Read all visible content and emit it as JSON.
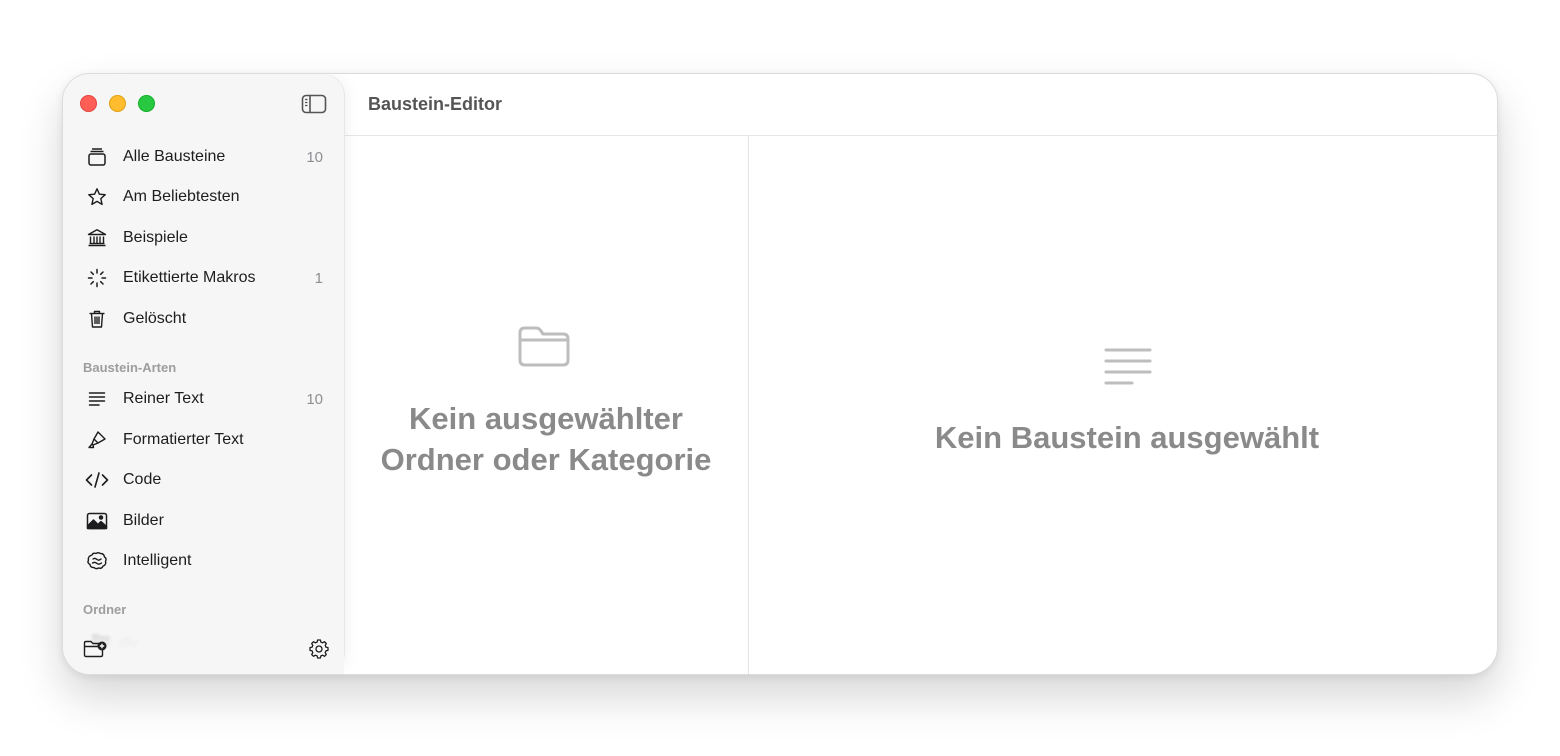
{
  "window": {
    "title": "Baustein-Editor"
  },
  "sidebar": {
    "library_items": [
      {
        "label": "Alle Bausteine",
        "count": "10",
        "icon": "tray-stack-icon"
      },
      {
        "label": "Am Beliebtesten",
        "count": "",
        "icon": "star-icon"
      },
      {
        "label": "Beispiele",
        "count": "",
        "icon": "building-columns-icon"
      },
      {
        "label": "Etikettierte Makros",
        "count": "1",
        "icon": "sparkle-burst-icon"
      },
      {
        "label": "Gelöscht",
        "count": "",
        "icon": "trash-icon"
      }
    ],
    "types_heading": "Baustein-Arten",
    "type_items": [
      {
        "label": "Reiner Text",
        "count": "10",
        "icon": "text-lines-icon"
      },
      {
        "label": "Formatierter Text",
        "count": "",
        "icon": "highlighter-icon"
      },
      {
        "label": "Code",
        "count": "",
        "icon": "code-brackets-icon"
      },
      {
        "label": "Bilder",
        "count": "",
        "icon": "photo-icon"
      },
      {
        "label": "Intelligent",
        "count": "",
        "icon": "brain-icon"
      }
    ],
    "folders_heading": "Ordner",
    "folders": [
      {
        "label": "djv",
        "icon": "folder-icon"
      }
    ]
  },
  "list_pane": {
    "empty_message_line1": "Kein ausgewählter",
    "empty_message_line2": "Ordner oder Kategorie",
    "icon": "folder-icon"
  },
  "editor_pane": {
    "empty_message": "Kein Baustein ausgewählt",
    "icon": "text-lines-icon"
  },
  "colors": {
    "close": "#ff5f57",
    "minimize": "#febc2e",
    "zoom": "#28c840",
    "sidebar_bg": "#f6f6f6",
    "placeholder_text": "#8a8a8a"
  }
}
